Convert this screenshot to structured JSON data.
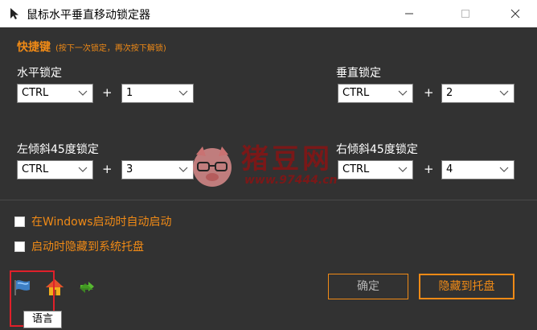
{
  "window": {
    "title": "鼠标水平垂直移动锁定器"
  },
  "shortcuts": {
    "heading": "快捷键",
    "hint": "(按下一次锁定，再次按下解锁)",
    "horizontal": {
      "label": "水平锁定",
      "modifier": "CTRL",
      "key": "1"
    },
    "vertical": {
      "label": "垂直锁定",
      "modifier": "CTRL",
      "key": "2"
    },
    "left45": {
      "label": "左倾斜45度锁定",
      "modifier": "CTRL",
      "key": "3"
    },
    "right45": {
      "label": "右倾斜45度锁定",
      "modifier": "CTRL",
      "key": "4"
    },
    "plus": "+"
  },
  "options": {
    "startup_label": "在Windows启动时自动启动",
    "startup_checked": false,
    "tray_label": "启动时隐藏到系统托盘",
    "tray_checked": false
  },
  "toolbar": {
    "language_tooltip": "语言",
    "icons": [
      "flag-icon",
      "home-icon",
      "refresh-icon"
    ]
  },
  "buttons": {
    "ok_label": "确定",
    "hide_label": "隐藏到托盘"
  },
  "watermark": {
    "brand": "猪豆网",
    "url": "www.97444.cn"
  },
  "colors": {
    "accent": "#f08a16",
    "panel_bg": "#323232",
    "highlight": "#e0202a"
  }
}
